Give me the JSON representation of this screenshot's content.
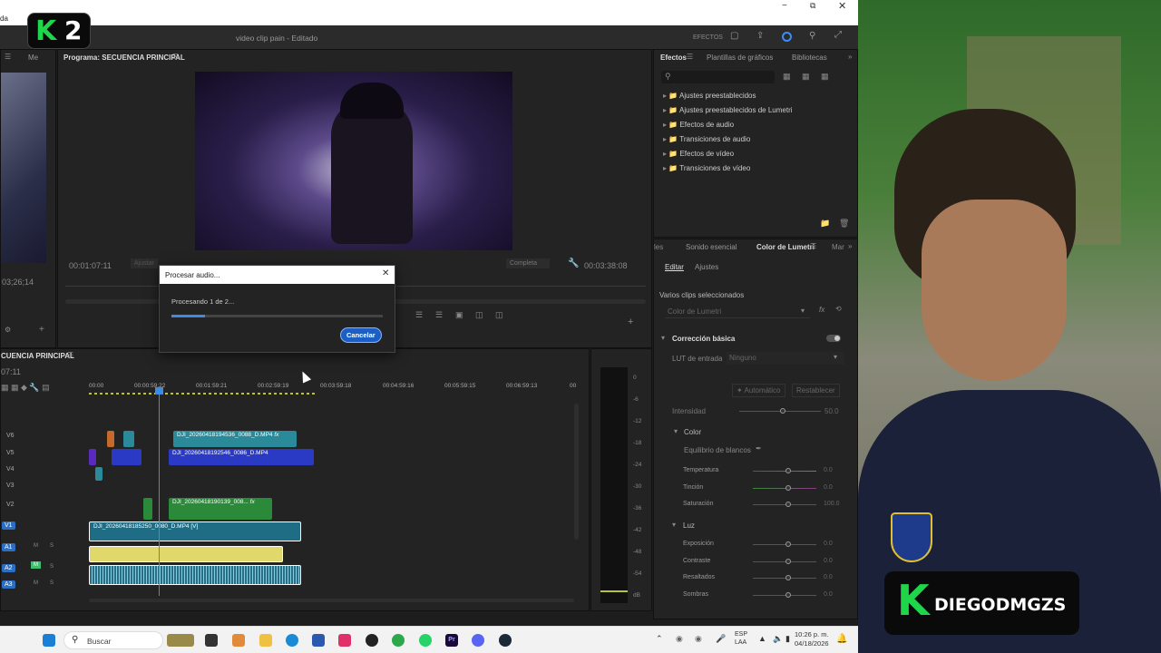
{
  "window": {
    "title": "video clip pain - Editado",
    "left_fragment": "da",
    "effects_label": "EFECTOS"
  },
  "source_panel": {
    "tab_fragment": "Me",
    "timecode": "03;26;14"
  },
  "program": {
    "title": "Programa: SECUENCIA PRINCIPAL",
    "timecode_left": "00:01:07:11",
    "fit_label": "Ajustar",
    "quality_label": "Completa",
    "timecode_right": "00:03:38:08"
  },
  "effects_panel": {
    "tabs": [
      "Efectos",
      "Plantillas de gráficos",
      "Bibliotecas"
    ],
    "items": [
      "Ajustes preestablecidos",
      "Ajustes preestablecidos de Lumetri",
      "Efectos de audio",
      "Transiciones de audio",
      "Efectos de vídeo",
      "Transiciones de vídeo"
    ]
  },
  "lumetri": {
    "tabs": [
      "les",
      "Sonido esencial",
      "Color de Lumetri",
      "Mar"
    ],
    "subtabs": [
      "Editar",
      "Ajustes"
    ],
    "clips_label": "Varios clips seleccionados",
    "effect_dropdown": "Color de Lumetri",
    "basic_correction": "Corrección básica",
    "lut_label": "LUT de entrada",
    "lut_value": "Ninguno",
    "auto_button": "Automático",
    "reset_button": "Restablecer",
    "intensity_label": "Intensidad",
    "intensity_value": "50.0",
    "color_section": "Color",
    "wb_label": "Equilibrio de blancos",
    "temp_label": "Temperatura",
    "temp_value": "0.0",
    "tint_label": "Tinción",
    "tint_value": "0.0",
    "sat_label": "Saturación",
    "sat_value": "100.0",
    "light_section": "Luz",
    "exposure_label": "Exposición",
    "exposure_value": "0.0",
    "contrast_label": "Contraste",
    "contrast_value": "0.0",
    "highlights_label": "Resaltados",
    "highlights_value": "0.0",
    "shadows_label": "Sombras",
    "shadows_value": "0.0"
  },
  "dialog": {
    "title": "Procesar audio...",
    "message": "Procesando 1 de 2...",
    "progress": 0.16,
    "cancel": "Cancelar"
  },
  "timeline": {
    "title": "CUENCIA PRINCIPAL",
    "timecode": "07:11",
    "ruler": [
      "00:00",
      "00:00:59:22",
      "00:01:59:21",
      "00:02:59:19",
      "00:03:59:18",
      "00:04:59:16",
      "00:05:59:15",
      "00:06:59:13",
      "00"
    ],
    "tracks": [
      "V6",
      "V5",
      "V4",
      "V3",
      "V2",
      "V1",
      "A1",
      "A2",
      "A3"
    ],
    "clips": {
      "v6": "DJI_20260418194536_0088_D.MP4",
      "v5": "DJI_20260418192546_0086_D.MP4",
      "v2": "DJI_20260418190139_008...",
      "v1": "DJI_20260418185250_0080_D.MP4 [V]"
    },
    "fx": "fx",
    "mute": "M",
    "solo": "S"
  },
  "meter": {
    "scale": [
      "0",
      "-6",
      "-12",
      "-18",
      "-24",
      "-30",
      "-36",
      "-42",
      "-48",
      "-54",
      "dB"
    ]
  },
  "taskbar": {
    "search": "Buscar",
    "lang1": "ESP",
    "lang2": "LAA",
    "time": "10:26 p. m.",
    "date": "04/18/2026"
  },
  "overlay": {
    "logo_k": "K",
    "logo_2": "2",
    "channel": "DIEGODMGZS"
  }
}
